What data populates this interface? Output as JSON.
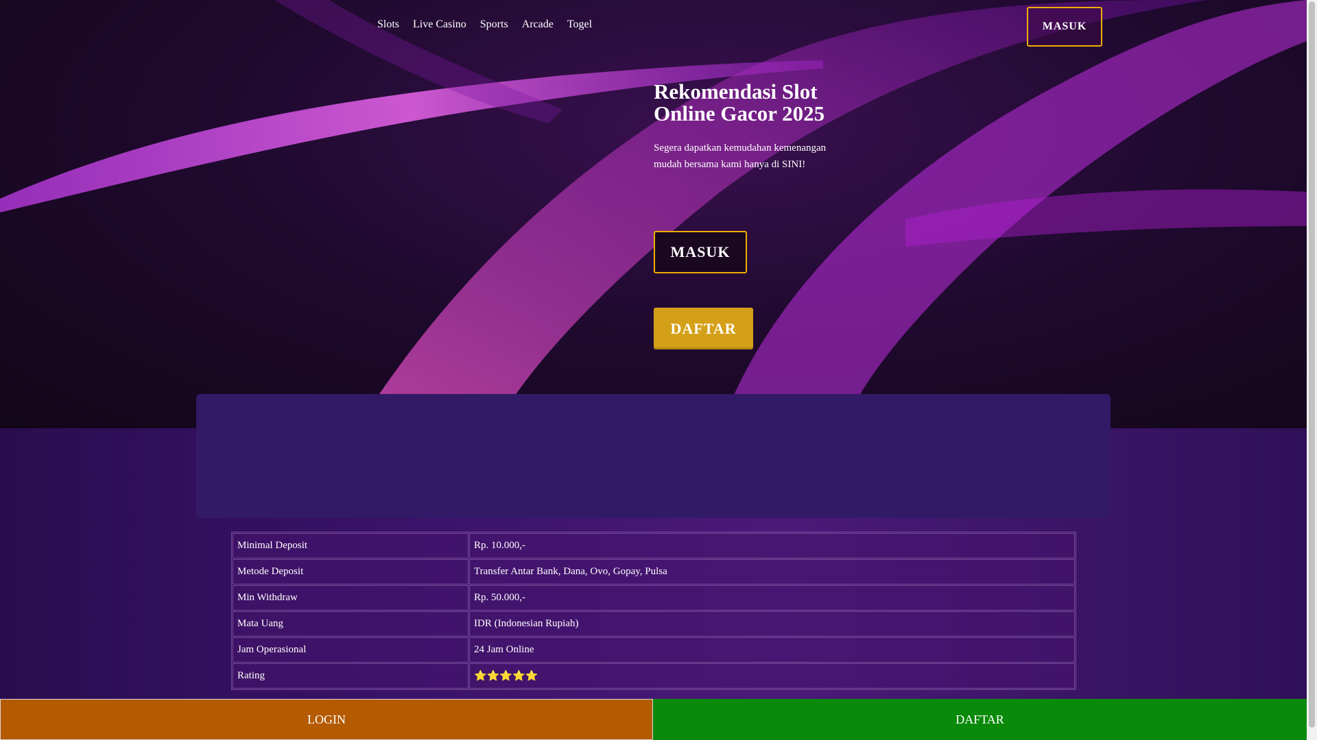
{
  "nav": {
    "items": [
      "Slots",
      "Live Casino",
      "Sports",
      "Arcade",
      "Togel"
    ]
  },
  "header": {
    "masuk_label": "MASUK"
  },
  "hero": {
    "title": "Rekomendasi Slot Online Gacor 2025",
    "subtitle": "Segera dapatkan kemudahan kemenangan mudah bersama kami hanya di SINI!",
    "masuk_label": "MASUK",
    "daftar_label": "DAFTAR"
  },
  "info_table": {
    "rows": [
      {
        "key": "Minimal Deposit",
        "value": "Rp. 10.000,-"
      },
      {
        "key": "Metode Deposit",
        "value": "Transfer Antar Bank, Dana, Ovo, Gopay, Pulsa"
      },
      {
        "key": "Min Withdraw",
        "value": "Rp. 50.000,-"
      },
      {
        "key": "Mata Uang",
        "value": "IDR (Indonesian Rupiah)"
      },
      {
        "key": "Jam Operasional",
        "value": "24 Jam Online"
      },
      {
        "key": "Rating",
        "value": "⭐⭐⭐⭐⭐"
      }
    ]
  },
  "bottom_bar": {
    "login_label": "LOGIN",
    "daftar_label": "DAFTAR"
  },
  "colors": {
    "accent_gold": "#f0b000",
    "daftar_gold": "#d4a017",
    "login_orange": "#b45a00",
    "daftar_green": "#0a8a0a",
    "panel_purple": "#321a66"
  }
}
